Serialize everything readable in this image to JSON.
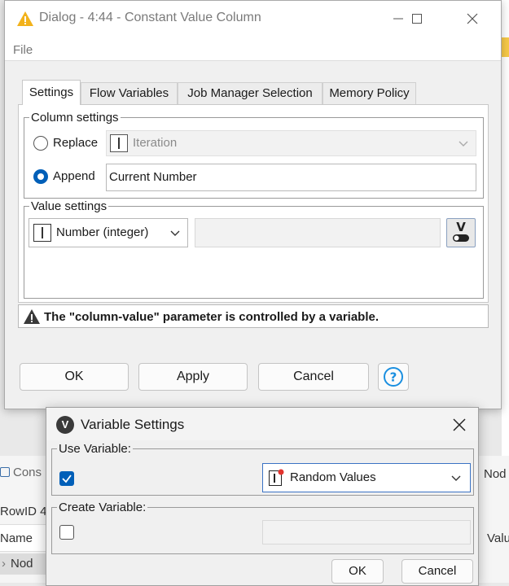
{
  "window": {
    "title": "Dialog - 4:44 - Constant Value Column",
    "menu": [
      "File"
    ]
  },
  "tabs": [
    "Settings",
    "Flow Variables",
    "Job Manager Selection",
    "Memory Policy"
  ],
  "column_settings": {
    "title": "Column settings",
    "replace_label": "Replace",
    "replace_column": "Iteration",
    "append_label": "Append",
    "append_value": "Current Number",
    "selected": "Append"
  },
  "value_settings": {
    "title": "Value settings",
    "type": "Number (integer)",
    "value": ""
  },
  "warning": "The \"column-value\" parameter is controlled by a variable.",
  "buttons": {
    "ok": "OK",
    "apply": "Apply",
    "cancel": "Cancel"
  },
  "background": {
    "console_tab": "Cons",
    "row_id": "RowID 4",
    "name_header": "Name",
    "node_item": "Nod",
    "right_node": "Nod",
    "right_value": "Valu"
  },
  "variable_dialog": {
    "title": "Variable Settings",
    "use_variable": {
      "label": "Use Variable:",
      "checked": true,
      "selected": "Random Values"
    },
    "create_variable": {
      "label": "Create Variable:",
      "checked": false,
      "value": ""
    },
    "ok": "OK",
    "cancel": "Cancel"
  },
  "colors": {
    "accent": "#005fb8",
    "warning_icon": "#3a3a3a",
    "title_icon": "#f2b21b"
  }
}
